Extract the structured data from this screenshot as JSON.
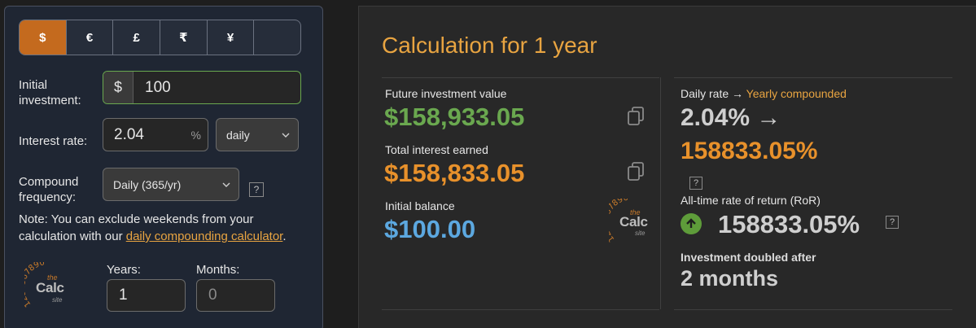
{
  "currency": {
    "buttons": [
      "$",
      "€",
      "£",
      "₹",
      "¥",
      ""
    ],
    "active_index": 0
  },
  "form": {
    "initial_investment_label": "Initial\ninvestment:",
    "initial_prefix": "$",
    "initial_value": "100",
    "interest_rate_label": "Interest rate:",
    "interest_rate_value": "2.04",
    "interest_rate_unit": "%",
    "rate_period": "daily",
    "compound_label": "Compound\nfrequency:",
    "compound_value": "Daily (365/yr)",
    "help_glyph": "?",
    "note_text": "Note: You can exclude weekends from your calculation with our ",
    "note_link": "daily compounding calculator",
    "note_end": ".",
    "years_label": "Years:",
    "years_value": "1",
    "months_label": "Months:",
    "months_placeholder": "0"
  },
  "logo": {
    "digits": "1234567890",
    "the": "the",
    "calc": "Calc",
    "site": "site"
  },
  "results": {
    "title": "Calculation for 1 year",
    "future_label": "Future investment value",
    "future_value": "$158,933.05",
    "interest_label": "Total interest earned",
    "interest_value": "$158,833.05",
    "initial_label": "Initial balance",
    "initial_value": "$100.00",
    "daily_rate_label": "Daily rate",
    "arrow": "→",
    "yearly_label": "Yearly compounded",
    "daily_rate_value": "2.04%",
    "yearly_value": "158833.05%",
    "ror_label": "All-time rate of return (RoR)",
    "ror_value": "158833.05%",
    "doubled_label": "Investment doubled after",
    "doubled_value": "2 months"
  },
  "colors": {
    "accent": "#c46a1e",
    "green": "#6aa84f",
    "orange": "#e8912b",
    "blue": "#5ca8e0"
  },
  "icons": [
    "copy-icon",
    "chevron-down-icon",
    "help-icon",
    "arrow-up-icon",
    "right-arrow-icon"
  ]
}
